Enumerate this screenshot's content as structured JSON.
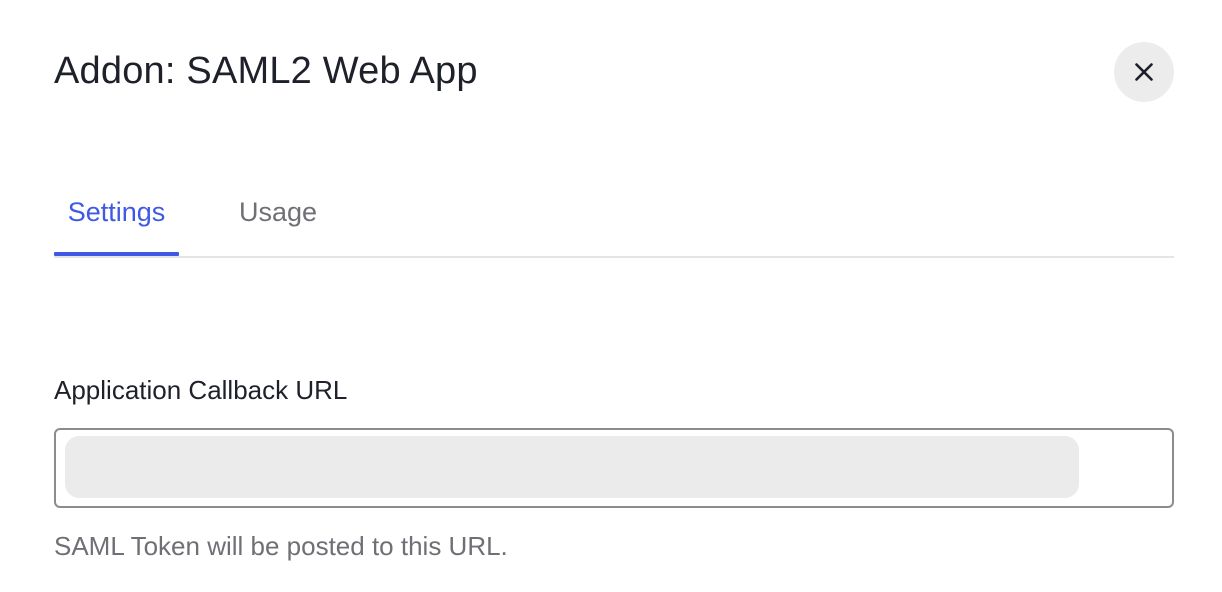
{
  "dialog": {
    "title": "Addon: SAML2 Web App",
    "close_icon": "close-icon"
  },
  "tabs": [
    {
      "label": "Settings",
      "active": true
    },
    {
      "label": "Usage",
      "active": false
    }
  ],
  "form": {
    "callback_url": {
      "label": "Application Callback URL",
      "value": "",
      "helper": "SAML Token will be posted to this URL."
    }
  },
  "colors": {
    "accent": "#3f59e4",
    "text_primary": "#1e212a",
    "text_secondary": "#6f6f76",
    "close_bg": "#ececec",
    "input_border": "#8c8c8c",
    "redacted_fill": "#ebebeb"
  }
}
